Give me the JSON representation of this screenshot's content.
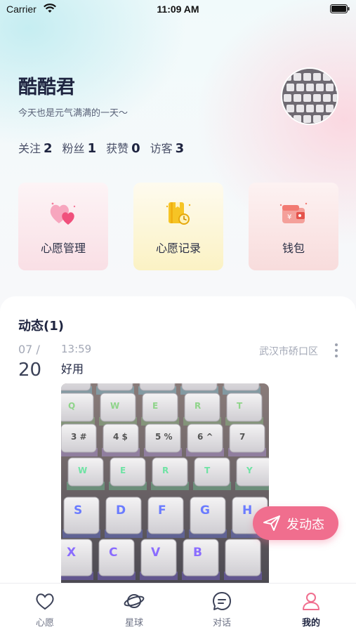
{
  "status_bar": {
    "carrier": "Carrier",
    "time": "11:09 AM"
  },
  "profile": {
    "name": "酷酷君",
    "bio": "今天也是元气满满的一天～",
    "stats": [
      {
        "label": "关注",
        "value": "2"
      },
      {
        "label": "粉丝",
        "value": "1"
      },
      {
        "label": "获赞",
        "value": "0"
      },
      {
        "label": "访客",
        "value": "3"
      }
    ]
  },
  "features": [
    {
      "label": "心愿管理",
      "icon": "hearts-icon"
    },
    {
      "label": "心愿记录",
      "icon": "notebook-clock-icon"
    },
    {
      "label": "钱包",
      "icon": "wallet-icon"
    }
  ],
  "feed": {
    "title": "动态(1)",
    "post": {
      "month": "07 /",
      "day": "20",
      "time": "13:59",
      "location": "武汉市硚口区",
      "text": "好用",
      "keys": [
        [
          "",
          "",
          "",
          "",
          ""
        ],
        [
          "Q",
          "W",
          "E",
          "R",
          "T"
        ],
        [
          "3 #",
          "4 $",
          "5 %",
          "6 ^",
          "7"
        ],
        [
          "W",
          "E",
          "R",
          "T",
          "Y"
        ],
        [
          "S",
          "D",
          "F",
          "G",
          "H"
        ],
        [
          "X",
          "C",
          "V",
          "B",
          ""
        ]
      ]
    }
  },
  "fab": {
    "label": "发动态"
  },
  "tabbar": {
    "tabs": [
      {
        "label": "心愿",
        "icon": "heart-outline-icon"
      },
      {
        "label": "星球",
        "icon": "planet-icon"
      },
      {
        "label": "对话",
        "icon": "chat-icon"
      },
      {
        "label": "我的",
        "icon": "person-icon"
      }
    ]
  },
  "colors": {
    "accent": "#f06e8e",
    "text": "#1e2440",
    "muted": "#a3a8b6"
  }
}
